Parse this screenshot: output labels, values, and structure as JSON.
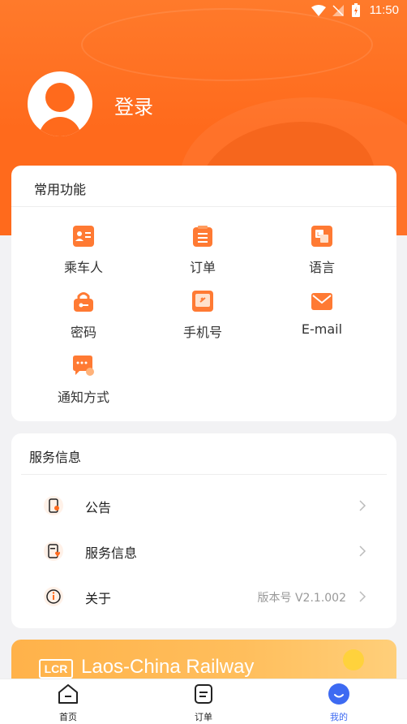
{
  "status_bar": {
    "time": "11:50"
  },
  "profile": {
    "login_label": "登录"
  },
  "common_functions": {
    "title": "常用功能",
    "items": [
      {
        "label": "乘车人",
        "icon": "passenger-icon"
      },
      {
        "label": "订单",
        "icon": "order-icon"
      },
      {
        "label": "语言",
        "icon": "language-icon"
      },
      {
        "label": "密码",
        "icon": "password-icon"
      },
      {
        "label": "手机号",
        "icon": "phone-icon"
      },
      {
        "label": "E-mail",
        "icon": "email-icon"
      },
      {
        "label": "通知方式",
        "icon": "notification-icon"
      }
    ]
  },
  "service_info": {
    "title": "服务信息",
    "rows": [
      {
        "label": "公告",
        "value": "",
        "icon": "announcement-icon"
      },
      {
        "label": "服务信息",
        "value": "",
        "icon": "service-info-icon"
      },
      {
        "label": "关于",
        "value": "版本号 V2.1.002",
        "icon": "info-icon"
      }
    ]
  },
  "banner": {
    "logo": "LCR",
    "text": "Laos-China Railway"
  },
  "tabbar": {
    "items": [
      {
        "label": "首页",
        "icon": "home-icon"
      },
      {
        "label": "订单",
        "icon": "order-tab-icon"
      },
      {
        "label": "我的",
        "icon": "profile-tab-icon"
      }
    ],
    "active_index": 2
  },
  "colors": {
    "accent": "#ff6a1c",
    "active_tab": "#3d6af2"
  }
}
